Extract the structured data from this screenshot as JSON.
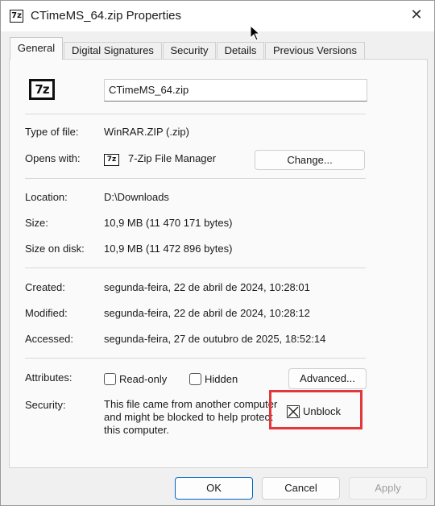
{
  "window": {
    "title": "CTimeMS_64.zip Properties",
    "app_icon_text": "7z",
    "close_glyph": "✕"
  },
  "tabs": [
    {
      "label": "General",
      "active": true
    },
    {
      "label": "Digital Signatures",
      "active": false
    },
    {
      "label": "Security",
      "active": false
    },
    {
      "label": "Details",
      "active": false
    },
    {
      "label": "Previous Versions",
      "active": false
    }
  ],
  "general": {
    "file_icon_text": "7z",
    "file_name": "CTimeMS_64.zip",
    "type_label": "Type of file:",
    "type_value": "WinRAR.ZIP (.zip)",
    "opens_label": "Opens with:",
    "opens_icon_text": "7z",
    "opens_value": "7-Zip File Manager",
    "change_button": "Change...",
    "location_label": "Location:",
    "location_value": "D:\\Downloads",
    "size_label": "Size:",
    "size_value": "10,9 MB (11 470 171 bytes)",
    "size_on_disk_label": "Size on disk:",
    "size_on_disk_value": "10,9 MB (11 472 896 bytes)",
    "created_label": "Created:",
    "created_value": "segunda-feira, 22 de abril de 2024, 10:28:01",
    "modified_label": "Modified:",
    "modified_value": "segunda-feira, 22 de abril de 2024, 10:28:12",
    "accessed_label": "Accessed:",
    "accessed_value": "segunda-feira, 27 de outubro de 2025, 18:52:14",
    "attributes_label": "Attributes:",
    "readonly_label": "Read-only",
    "readonly_checked": false,
    "hidden_label": "Hidden",
    "hidden_checked": false,
    "advanced_button": "Advanced...",
    "security_label": "Security:",
    "security_text": "This file came from another computer and might be blocked to help protect this computer.",
    "unblock_label": "Unblock",
    "unblock_checked": true
  },
  "footer": {
    "ok": "OK",
    "cancel": "Cancel",
    "apply": "Apply",
    "apply_enabled": false
  },
  "colors": {
    "highlight": "#e2373b",
    "primary_border": "#0067c0"
  }
}
